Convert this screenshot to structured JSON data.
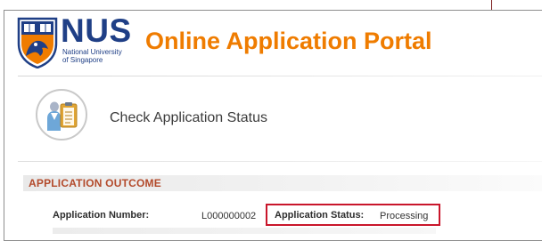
{
  "branding": {
    "acronym": "NUS",
    "subtitle_line1": "National University",
    "subtitle_line2": "of Singapore",
    "portal_title": "Online Application Portal",
    "colors": {
      "brand_blue": "#1f3f86",
      "brand_orange": "#ef7c00"
    }
  },
  "page": {
    "title": "Check Application Status",
    "icon": "applicant-clipboard-icon"
  },
  "section": {
    "title": "APPLICATION OUTCOME",
    "title_color": "#b34a2b"
  },
  "fields": {
    "application_number_label": "Application Number:",
    "application_number_value": "L000000002",
    "application_status_label": "Application Status:",
    "application_status_value": "Processing"
  },
  "highlight": {
    "color": "#c9162b"
  }
}
